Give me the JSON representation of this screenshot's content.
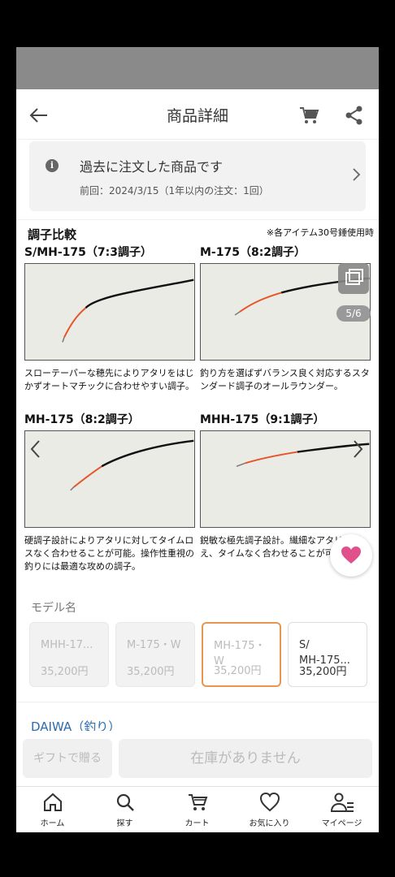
{
  "appbar": {
    "title": "商品詳細",
    "back_icon": "arrow-left-icon",
    "cart_icon": "cart-icon",
    "share_icon": "share-icon"
  },
  "notice": {
    "title": "過去に注文した商品です",
    "subtitle": "前回：2024/3/15（1年以内の注文：1回）",
    "info_glyph": "i"
  },
  "gallery": {
    "heading": "調子比較",
    "note": "※各アイテム30号錘使用時",
    "counter": "5/6",
    "rods": [
      {
        "label": "S/MH-175（7:3調子）",
        "desc": "スローテーパーな穂先によりアタリをはじかずオートマチックに合わせやすい調子。"
      },
      {
        "label": "M-175（8:2調子）",
        "desc": "釣り方を選ばずバランス良く対応するスタンダード調子のオールラウンダー。"
      },
      {
        "label": "MH-175（8:2調子）",
        "desc": "硬調子設計によりアタリに対してタイムロスなく合わせることが可能。操作性重視の釣りには最適な攻めの調子。"
      },
      {
        "label": "MHH-175（9:1調子）",
        "desc": "鋭敏な極先調子設計。繊細なアタリを捉え、タイムなく合わせることが可能。"
      }
    ]
  },
  "models": {
    "label": "モデル名",
    "items": [
      {
        "name": "MHH-17...",
        "price": "35,200円",
        "state": "disabled"
      },
      {
        "name": "M-175・W",
        "price": "35,200円",
        "state": "disabled"
      },
      {
        "name": "MH-175・\nW",
        "price": "35,200円",
        "state": "selected"
      },
      {
        "name": "S/\nMH-175...",
        "price": "35,200円",
        "state": "normal"
      }
    ]
  },
  "brand": "DAIWA（釣り）",
  "actions": {
    "gift": "ギフトで贈る",
    "stock": "在庫がありません"
  },
  "tabs": [
    {
      "label": "ホーム",
      "icon": "home-icon"
    },
    {
      "label": "探す",
      "icon": "search-icon"
    },
    {
      "label": "カート",
      "icon": "cart-icon"
    },
    {
      "label": "お気に入り",
      "icon": "heart-icon"
    },
    {
      "label": "マイページ",
      "icon": "profile-icon"
    }
  ],
  "colors": {
    "accent_heart": "#e0508a",
    "selected_border": "#e8954f",
    "brand_link": "#2b6cb0",
    "rod_tip": "#e8542a"
  }
}
